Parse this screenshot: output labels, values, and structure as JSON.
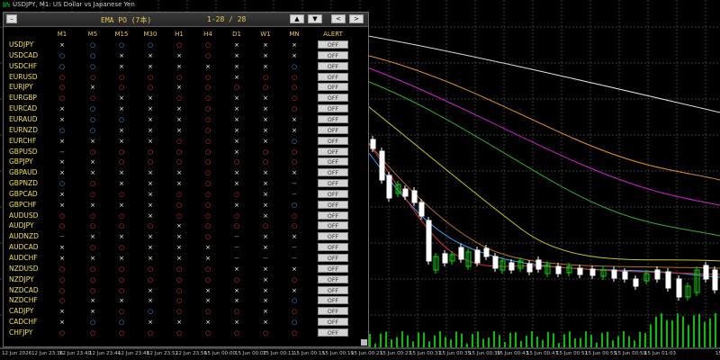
{
  "chart": {
    "title": "USDJPY, M1: US Dollar vs Japanese Yen",
    "time_labels": [
      "12 Jun 2026",
      "12 Jun 23:36",
      "12 Jun 23:40",
      "12 Jun 23:44",
      "12 Jun 23:48",
      "12 Jun 23:52",
      "12 Jun 23:56",
      "15 Jun 00:00",
      "15 Jun 00:07",
      "15 Jun 00:11",
      "15 Jun 00:15",
      "15 Jun 00:19",
      "15 Jun 00:23",
      "15 Jun 00:27",
      "15 Jun 00:31",
      "15 Jun 00:35",
      "15 Jun 00:39",
      "15 Jun 00:43",
      "15 Jun 00:47",
      "15 Jun 00:51",
      "15 Jun 00:55",
      "15 Jun 00:59",
      "15 Jun 01:03",
      "15"
    ],
    "colors": {
      "bull": "#00e000",
      "bear": "#ffffff",
      "grid": "#3c3c3c"
    }
  },
  "panel": {
    "title": "EMA PO (7本)",
    "range": "1-28 / 28",
    "buttons": {
      "minimize": "–",
      "up": "▲",
      "down": "▼",
      "prev": "<",
      "next": ">"
    },
    "columns": [
      "M1",
      "M5",
      "M15",
      "M30",
      "H1",
      "H4",
      "D1",
      "W1",
      "MN",
      "ALERT"
    ],
    "alert_label": "OFF",
    "legend": {
      "x": "×",
      "bo": "○",
      "ro": "○",
      "d": "--"
    },
    "rows": [
      {
        "symbol": "USDJPY",
        "cells": [
          "x",
          "bo",
          "bo",
          "bo",
          "ro",
          "ro",
          "x",
          "x",
          "x"
        ]
      },
      {
        "symbol": "USDCAD",
        "cells": [
          "bo",
          "bo",
          "x",
          "x",
          "x",
          "ro",
          "x",
          "x",
          "x"
        ]
      },
      {
        "symbol": "USDCHF",
        "cells": [
          "bo",
          "bo",
          "x",
          "x",
          "x",
          "x",
          "x",
          "x",
          "bo"
        ]
      },
      {
        "symbol": "EURUSD",
        "cells": [
          "ro",
          "ro",
          "ro",
          "ro",
          "ro",
          "ro",
          "x",
          "ro",
          "ro"
        ]
      },
      {
        "symbol": "EURJPY",
        "cells": [
          "ro",
          "x",
          "ro",
          "ro",
          "x",
          "ro",
          "ro",
          "ro",
          "ro"
        ]
      },
      {
        "symbol": "EURGBP",
        "cells": [
          "ro",
          "ro",
          "x",
          "x",
          "ro",
          "ro",
          "x",
          "x",
          "ro"
        ]
      },
      {
        "symbol": "EURCAD",
        "cells": [
          "x",
          "bo",
          "x",
          "x",
          "x",
          "ro",
          "x",
          "x",
          "ro"
        ]
      },
      {
        "symbol": "EURAUD",
        "cells": [
          "x",
          "bo",
          "bo",
          "x",
          "x",
          "ro",
          "x",
          "x",
          "x"
        ]
      },
      {
        "symbol": "EURNZD",
        "cells": [
          "bo",
          "bo",
          "x",
          "x",
          "x",
          "ro",
          "x",
          "x",
          "x"
        ]
      },
      {
        "symbol": "EURCHF",
        "cells": [
          "x",
          "x",
          "x",
          "x",
          "ro",
          "ro",
          "x",
          "x",
          "bo"
        ]
      },
      {
        "symbol": "GBPUSD",
        "cells": [
          "d",
          "ro",
          "ro",
          "ro",
          "ro",
          "ro",
          "x",
          "ro",
          "ro"
        ]
      },
      {
        "symbol": "GBPJPY",
        "cells": [
          "x",
          "x",
          "ro",
          "ro",
          "ro",
          "ro",
          "ro",
          "ro",
          "ro"
        ]
      },
      {
        "symbol": "GBPAUD",
        "cells": [
          "x",
          "x",
          "x",
          "x",
          "x",
          "ro",
          "x",
          "x",
          "x"
        ]
      },
      {
        "symbol": "GBPNZD",
        "cells": [
          "bo",
          "ro",
          "x",
          "x",
          "x",
          "ro",
          "x",
          "x",
          "d"
        ]
      },
      {
        "symbol": "GBPCAD",
        "cells": [
          "x",
          "ro",
          "ro",
          "x",
          "ro",
          "ro",
          "ro",
          "x",
          "d"
        ]
      },
      {
        "symbol": "GBPCHF",
        "cells": [
          "x",
          "x",
          "x",
          "x",
          "ro",
          "ro",
          "x",
          "x",
          "bo"
        ]
      },
      {
        "symbol": "AUDUSD",
        "cells": [
          "ro",
          "ro",
          "ro",
          "x",
          "ro",
          "ro",
          "ro",
          "x",
          "ro"
        ]
      },
      {
        "symbol": "AUDJPY",
        "cells": [
          "ro",
          "ro",
          "ro",
          "ro",
          "x",
          "ro",
          "ro",
          "ro",
          "ro"
        ]
      },
      {
        "symbol": "AUDNZD",
        "cells": [
          "d",
          "x",
          "x",
          "x",
          "x",
          "ro",
          "d",
          "x",
          "x"
        ]
      },
      {
        "symbol": "AUDCAD",
        "cells": [
          "x",
          "ro",
          "ro",
          "x",
          "x",
          "x",
          "d",
          "x",
          "d"
        ]
      },
      {
        "symbol": "AUDCHF",
        "cells": [
          "x",
          "x",
          "x",
          "x",
          "x",
          "x",
          "d",
          "d",
          "d"
        ]
      },
      {
        "symbol": "NZDUSD",
        "cells": [
          "ro",
          "ro",
          "ro",
          "ro",
          "ro",
          "ro",
          "x",
          "x",
          "x"
        ]
      },
      {
        "symbol": "NZDJPY",
        "cells": [
          "ro",
          "ro",
          "ro",
          "ro",
          "ro",
          "ro",
          "ro",
          "x",
          "ro"
        ]
      },
      {
        "symbol": "NZDCAD",
        "cells": [
          "ro",
          "ro",
          "ro",
          "x",
          "ro",
          "x",
          "x",
          "x",
          "x"
        ]
      },
      {
        "symbol": "NZDCHF",
        "cells": [
          "ro",
          "x",
          "x",
          "x",
          "ro",
          "x",
          "x",
          "x",
          "bo"
        ]
      },
      {
        "symbol": "CADJPY",
        "cells": [
          "x",
          "x",
          "ro",
          "bo",
          "ro",
          "ro",
          "ro",
          "x",
          "ro"
        ]
      },
      {
        "symbol": "CADCHF",
        "cells": [
          "x",
          "bo",
          "bo",
          "x",
          "x",
          "x",
          "x",
          "x",
          "bo"
        ]
      },
      {
        "symbol": "CHFJPY",
        "cells": [
          "ro",
          "ro",
          "ro",
          "ro",
          "ro",
          "ro",
          "ro",
          "ro",
          "ro"
        ]
      }
    ]
  }
}
